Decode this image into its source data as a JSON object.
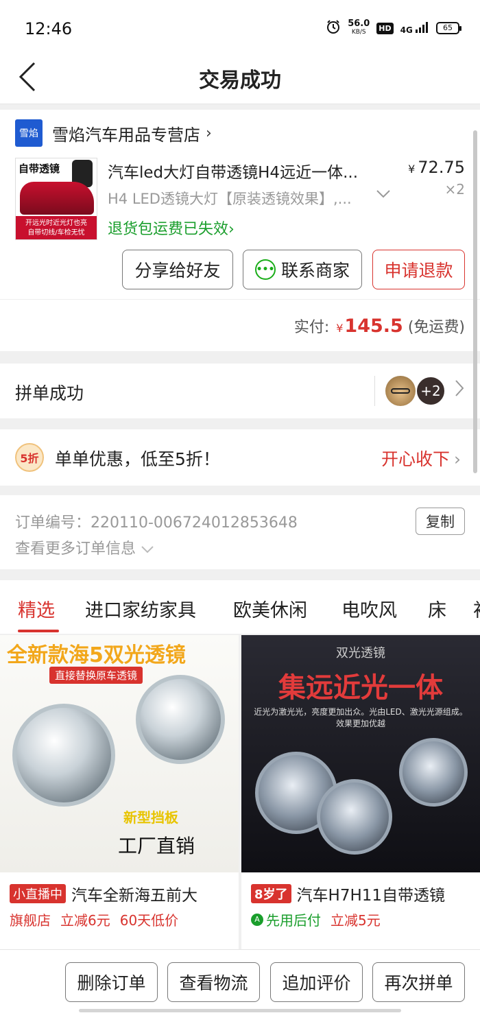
{
  "status_bar": {
    "time": "12:46",
    "net_speed": "56.0",
    "net_unit": "KB/S",
    "hd": "HD",
    "signal": "4G",
    "battery": "65"
  },
  "nav": {
    "title": "交易成功"
  },
  "shop": {
    "logo_text": "雪焰",
    "name": "雪焰汽车用品专营店",
    "chevron": "›"
  },
  "product": {
    "image_text_top": "自带透镜",
    "image_text_band": "开远光时近光灯也亮",
    "image_text_band2": "自带切线/车检无忧",
    "title": "汽车led大灯自带透镜H4远近一体...",
    "price_symbol": "¥",
    "price": "72.75",
    "quantity": "×2",
    "spec": "H4 LED透镜大灯【原装透镜效果】,...",
    "return_notice": "退货包运费已失效›"
  },
  "actions": {
    "share": "分享给好友",
    "contact": "联系商家",
    "refund": "申请退款"
  },
  "payment": {
    "label": "实付:",
    "symbol": "¥",
    "amount": "145.5",
    "note": "(免运费)"
  },
  "group": {
    "label": "拼单成功",
    "extra_count": "+2"
  },
  "promo": {
    "badge": "5折",
    "text": "单单优惠，低至5折！",
    "action": "开心收下"
  },
  "order_info": {
    "order_no": "订单编号：220110-006724012853648",
    "copy": "复制",
    "more": "查看更多订单信息"
  },
  "tabs": [
    "精选",
    "进口家纺家具",
    "欧美休闲",
    "电吹风",
    "床",
    "衬"
  ],
  "recommendations": [
    {
      "img_head": "全新款海5双光透镜",
      "img_sub": "直接替换原车透镜",
      "img_tag1": "新型挡板",
      "img_tag2": "工厂直销",
      "badge": "小直播中",
      "title": "汽车全新海五前大",
      "tags": [
        "旗舰店",
        "立减6元",
        "60天低价"
      ]
    },
    {
      "img_top": "双光透镜",
      "img_head": "集远近光一体",
      "img_desc": "近光为激光光，亮度更加出众。光由LED、激光光源组成。效果更加优越",
      "badge": "8岁了",
      "title": "汽车H7H11自带透镜",
      "tags": [
        "先用后付",
        "立减5元"
      ]
    }
  ],
  "bottom_actions": [
    "删除订单",
    "查看物流",
    "追加评价",
    "再次拼单"
  ]
}
